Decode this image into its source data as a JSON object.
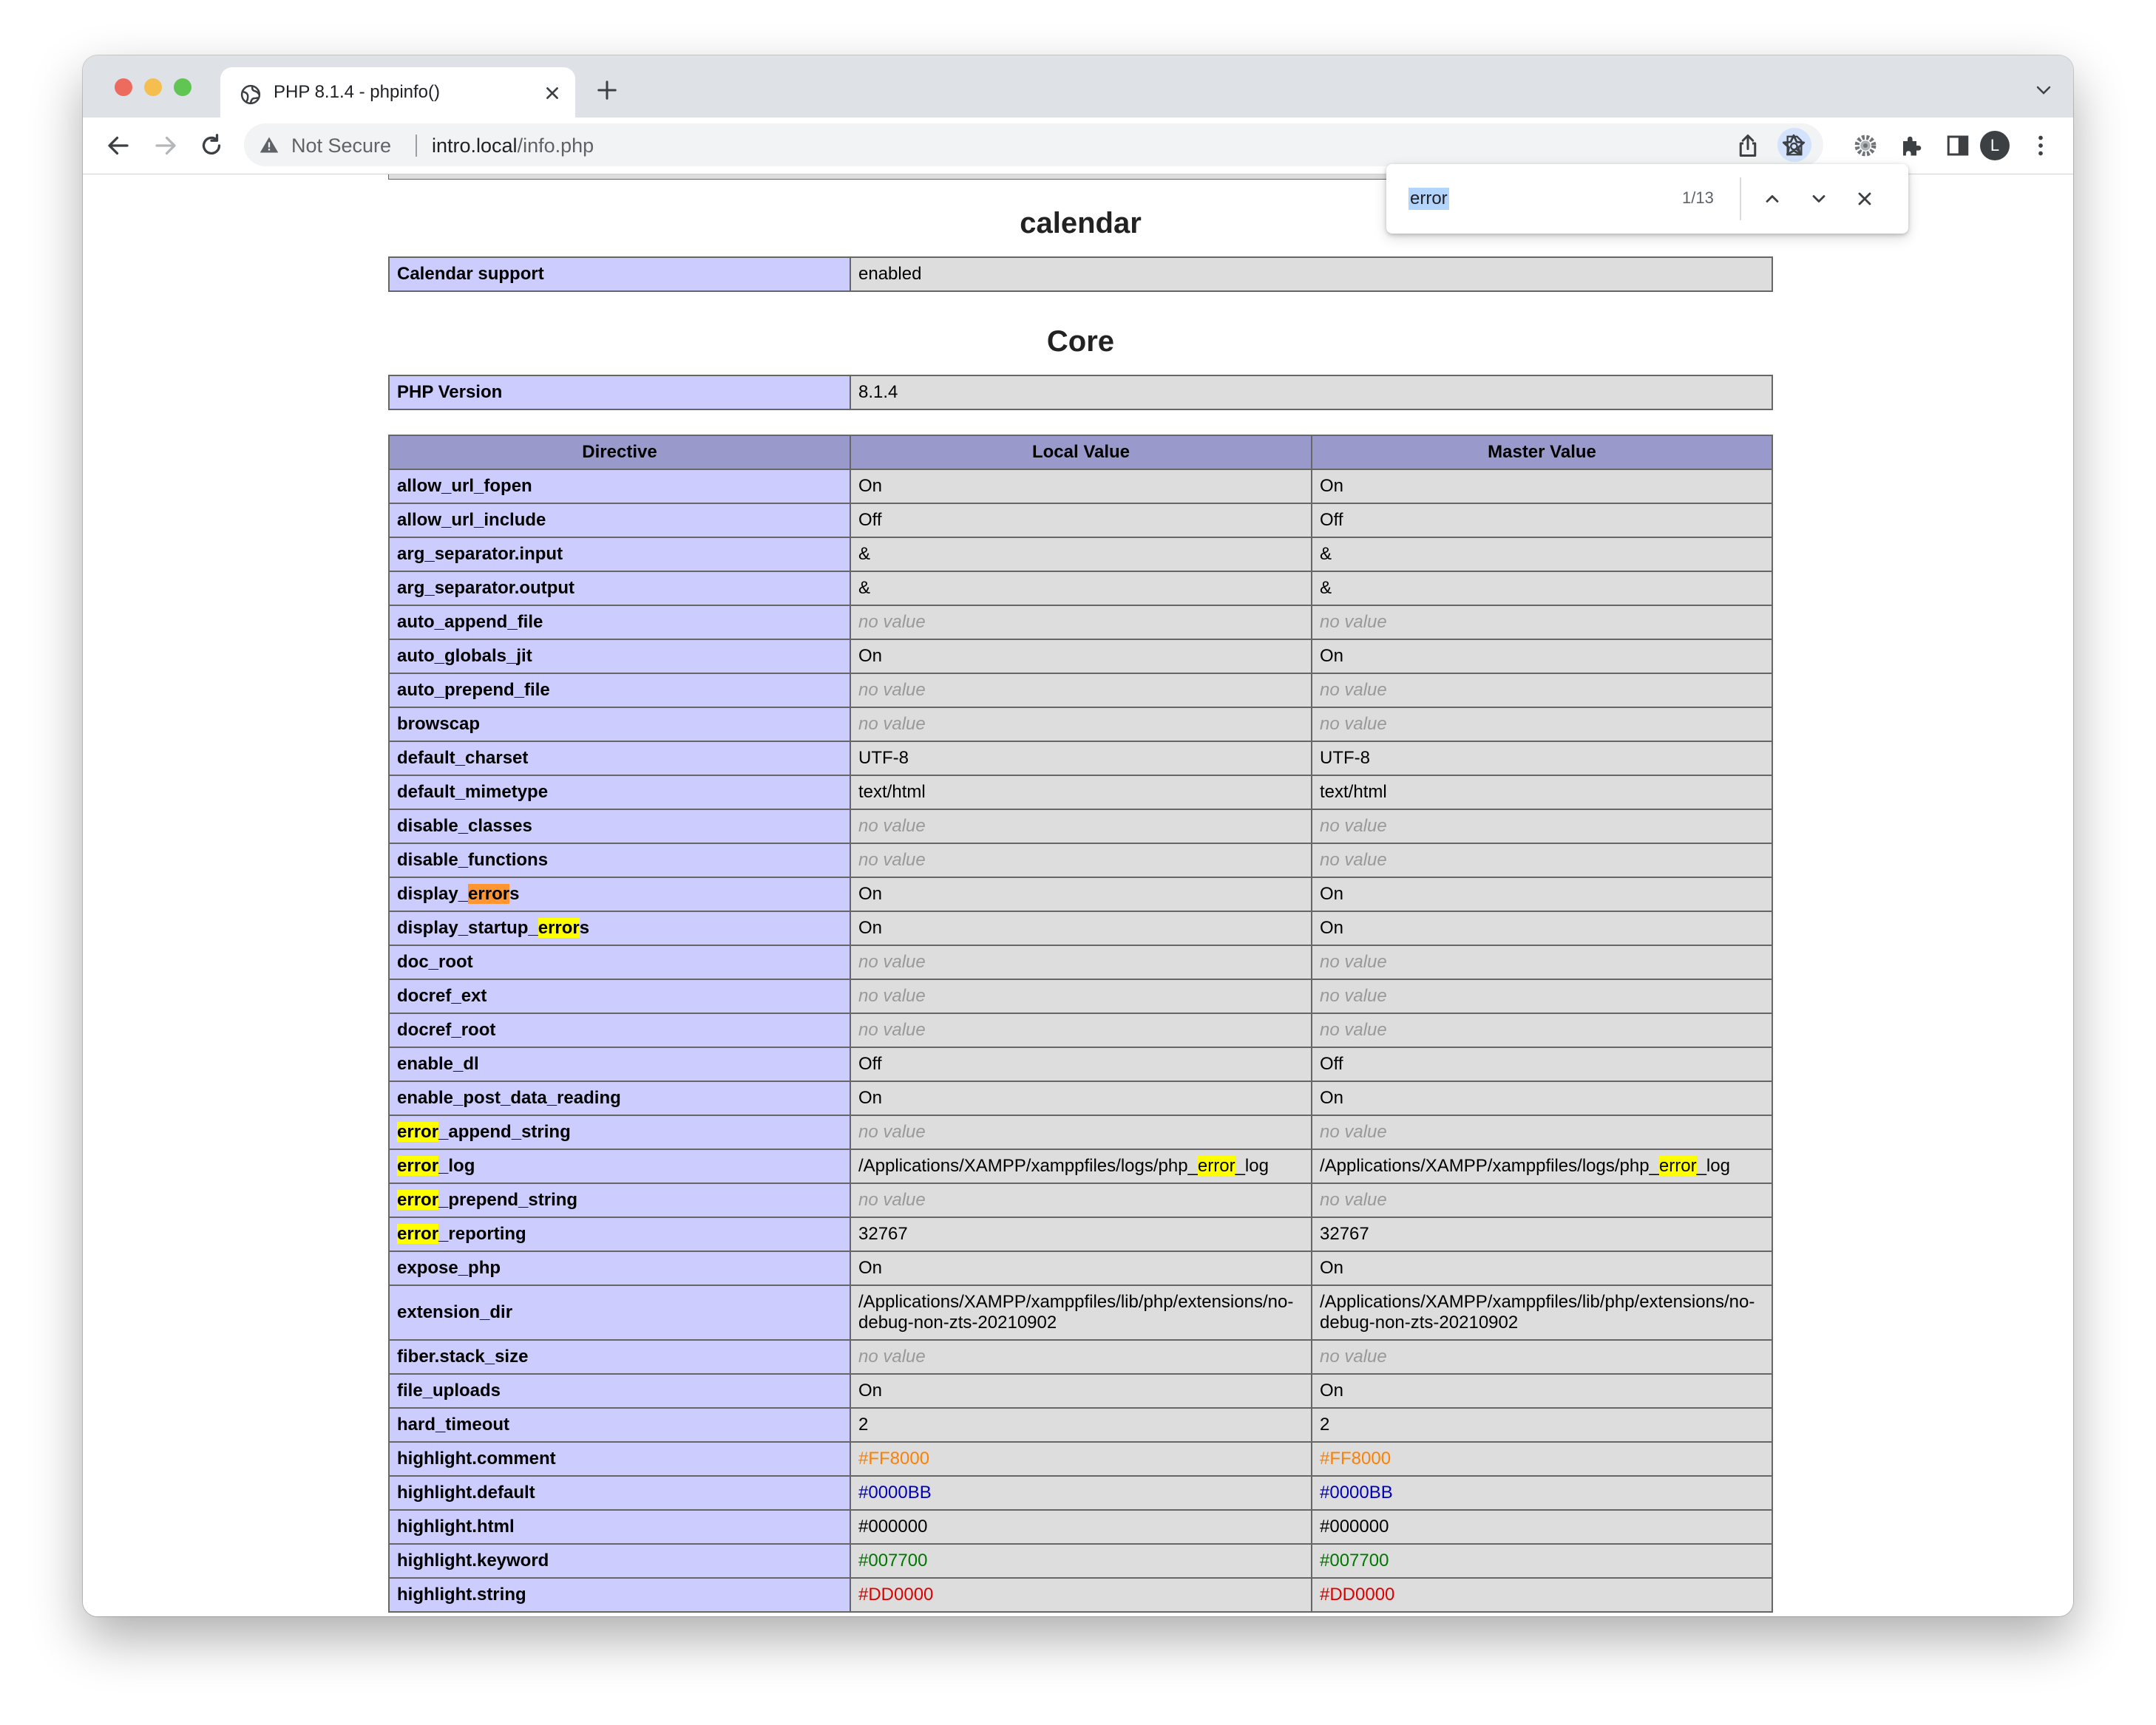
{
  "browser": {
    "tab_title": "PHP 8.1.4 - phpinfo()",
    "security_label": "Not Secure",
    "url_host": "intro.local",
    "url_path": "/info.php",
    "avatar_letter": "L"
  },
  "find_bar": {
    "query": "error",
    "count": "1/13"
  },
  "sections": {
    "calendar": {
      "title": "calendar",
      "support_label": "Calendar support",
      "support_value": "enabled"
    },
    "core": {
      "title": "Core",
      "version_label": "PHP Version",
      "version_value": "8.1.4",
      "headers": [
        "Directive",
        "Local Value",
        "Master Value"
      ],
      "rows": [
        {
          "d": [
            "allow_url_fopen"
          ],
          "l": [
            "On"
          ],
          "m": [
            "On"
          ]
        },
        {
          "d": [
            "allow_url_include"
          ],
          "l": [
            "Off"
          ],
          "m": [
            "Off"
          ]
        },
        {
          "d": [
            "arg_separator.input"
          ],
          "l": [
            "&"
          ],
          "m": [
            "&"
          ]
        },
        {
          "d": [
            "arg_separator.output"
          ],
          "l": [
            "&"
          ],
          "m": [
            "&"
          ]
        },
        {
          "d": [
            "auto_append_file"
          ],
          "l": [
            "no value"
          ],
          "m": [
            "no value"
          ],
          "nv": true
        },
        {
          "d": [
            "auto_globals_jit"
          ],
          "l": [
            "On"
          ],
          "m": [
            "On"
          ]
        },
        {
          "d": [
            "auto_prepend_file"
          ],
          "l": [
            "no value"
          ],
          "m": [
            "no value"
          ],
          "nv": true
        },
        {
          "d": [
            "browscap"
          ],
          "l": [
            "no value"
          ],
          "m": [
            "no value"
          ],
          "nv": true
        },
        {
          "d": [
            "default_charset"
          ],
          "l": [
            "UTF-8"
          ],
          "m": [
            "UTF-8"
          ]
        },
        {
          "d": [
            "default_mimetype"
          ],
          "l": [
            "text/html"
          ],
          "m": [
            "text/html"
          ]
        },
        {
          "d": [
            "disable_classes"
          ],
          "l": [
            "no value"
          ],
          "m": [
            "no value"
          ],
          "nv": true
        },
        {
          "d": [
            "disable_functions"
          ],
          "l": [
            "no value"
          ],
          "m": [
            "no value"
          ],
          "nv": true
        },
        {
          "d": [
            "display_",
            "error",
            "s"
          ],
          "l": [
            "On"
          ],
          "m": [
            "On"
          ],
          "current": true
        },
        {
          "d": [
            "display_startup_",
            "error",
            "s"
          ],
          "l": [
            "On"
          ],
          "m": [
            "On"
          ]
        },
        {
          "d": [
            "doc_root"
          ],
          "l": [
            "no value"
          ],
          "m": [
            "no value"
          ],
          "nv": true
        },
        {
          "d": [
            "docref_ext"
          ],
          "l": [
            "no value"
          ],
          "m": [
            "no value"
          ],
          "nv": true
        },
        {
          "d": [
            "docref_root"
          ],
          "l": [
            "no value"
          ],
          "m": [
            "no value"
          ],
          "nv": true
        },
        {
          "d": [
            "enable_dl"
          ],
          "l": [
            "Off"
          ],
          "m": [
            "Off"
          ]
        },
        {
          "d": [
            "enable_post_data_reading"
          ],
          "l": [
            "On"
          ],
          "m": [
            "On"
          ]
        },
        {
          "d": [
            "",
            "error",
            "_append_string"
          ],
          "l": [
            "no value"
          ],
          "m": [
            "no value"
          ],
          "nv": true
        },
        {
          "d": [
            "",
            "error",
            "_log"
          ],
          "l": [
            "/Applications/XAMPP/xamppfiles/logs/php_",
            "error",
            "_log"
          ],
          "m": [
            "/Applications/XAMPP/xamppfiles/logs/php_",
            "error",
            "_log"
          ]
        },
        {
          "d": [
            "",
            "error",
            "_prepend_string"
          ],
          "l": [
            "no value"
          ],
          "m": [
            "no value"
          ],
          "nv": true
        },
        {
          "d": [
            "",
            "error",
            "_reporting"
          ],
          "l": [
            "32767"
          ],
          "m": [
            "32767"
          ]
        },
        {
          "d": [
            "expose_php"
          ],
          "l": [
            "On"
          ],
          "m": [
            "On"
          ]
        },
        {
          "d": [
            "extension_dir"
          ],
          "l": [
            "/Applications/XAMPP/xamppfiles/lib/php/extensions/no-debug-non-zts-20210902"
          ],
          "m": [
            "/Applications/XAMPP/xamppfiles/lib/php/extensions/no-debug-non-zts-20210902"
          ],
          "tall": true
        },
        {
          "d": [
            "fiber.stack_size"
          ],
          "l": [
            "no value"
          ],
          "m": [
            "no value"
          ],
          "nv": true
        },
        {
          "d": [
            "file_uploads"
          ],
          "l": [
            "On"
          ],
          "m": [
            "On"
          ]
        },
        {
          "d": [
            "hard_timeout"
          ],
          "l": [
            "2"
          ],
          "m": [
            "2"
          ]
        },
        {
          "d": [
            "highlight.comment"
          ],
          "l": [
            "#FF8000"
          ],
          "m": [
            "#FF8000"
          ],
          "color": "#FF8000"
        },
        {
          "d": [
            "highlight.default"
          ],
          "l": [
            "#0000BB"
          ],
          "m": [
            "#0000BB"
          ],
          "color": "#0000BB"
        },
        {
          "d": [
            "highlight.html"
          ],
          "l": [
            "#000000"
          ],
          "m": [
            "#000000"
          ],
          "color": "#000000"
        },
        {
          "d": [
            "highlight.keyword"
          ],
          "l": [
            "#007700"
          ],
          "m": [
            "#007700"
          ],
          "color": "#007700"
        },
        {
          "d": [
            "highlight.string"
          ],
          "l": [
            "#DD0000"
          ],
          "m": [
            "#DD0000"
          ],
          "color": "#DD0000"
        }
      ]
    }
  },
  "colors": {
    "header_bg": "#9999cc",
    "directive_bg": "#ccccff",
    "value_bg": "#dddddd",
    "match_highlight": "#ffff00",
    "current_match": "#ff9632"
  }
}
